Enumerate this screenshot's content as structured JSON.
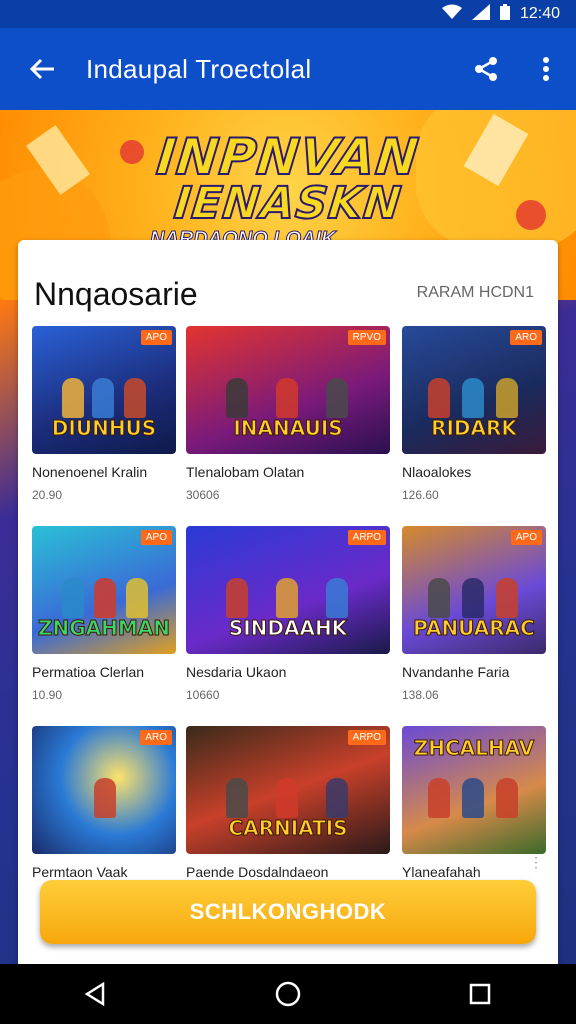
{
  "status": {
    "time": "12:40"
  },
  "appbar": {
    "title": "Indaupal Troectolal"
  },
  "hero": {
    "line1": "INPNVAN",
    "line2": "IENASKN",
    "sub": "NARDAONO LOAIK"
  },
  "section": {
    "heading": "Nnqaosarie",
    "more": "RARAM HCDN1"
  },
  "games": [
    {
      "name": "Nonenoenel Kralin",
      "score": "20.90",
      "banner": "DIUNHUS",
      "tag": "APO"
    },
    {
      "name": "Tlenalobam Olatan",
      "score": "30606",
      "banner": "INANAUIS",
      "tag": "RPVO"
    },
    {
      "name": "Nlaoalokes",
      "score": "126.60",
      "banner": "RIDARK",
      "tag": "ARO"
    },
    {
      "name": "Permatioa Clerlan",
      "score": "10.90",
      "banner": "ZNGAHMAN",
      "tag": "APO"
    },
    {
      "name": "Nesdaria Ukaon",
      "score": "10660",
      "banner": "SINDAAHK",
      "tag": "ARPO"
    },
    {
      "name": "Nvandanhe Faria",
      "score": "138.06",
      "banner": "PANUARAC",
      "tag": "APO"
    },
    {
      "name": "Permtaon Vaak",
      "score": "",
      "banner": "",
      "tag": "ARO"
    },
    {
      "name": "Paende Dosdalndaeon",
      "score": "",
      "banner": "CARNIATIS",
      "tag": "ARPO"
    },
    {
      "name": "Ylaneafahah",
      "score": "",
      "banner": "ZHCALHAV",
      "tag": ""
    }
  ],
  "cta": {
    "label": "SCHLKONGHODK"
  },
  "colors": {
    "appbar": "#0d4fc9",
    "cta": "#f7a70c",
    "accent": "#ff6a1a"
  }
}
